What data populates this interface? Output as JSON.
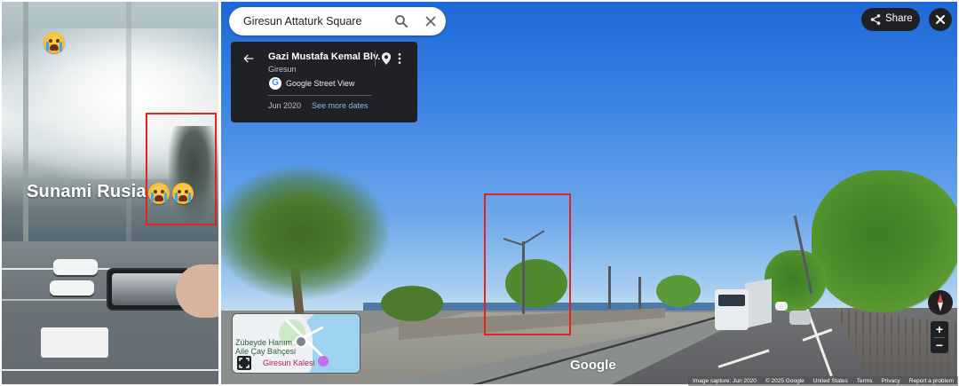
{
  "video_panel": {
    "caption": "Sunami Rusia",
    "emoji_icons": [
      "crying-face-icon",
      "crying-face-icon",
      "crying-face-icon"
    ],
    "highlight_color": "#e02424"
  },
  "street_view": {
    "search": {
      "query": "Giresun Attaturk Square",
      "search_icon": "search-icon",
      "clear_icon": "close-icon"
    },
    "info_card": {
      "street_name": "Gazi Mustafa Kemal Blv.",
      "city": "Giresun",
      "source_label": "Google Street View",
      "capture_date": "Jun 2020",
      "see_more_label": "See more dates"
    },
    "share_label": "Share",
    "zoom_in_label": "+",
    "zoom_out_label": "−",
    "watermark": "Google",
    "minimap": {
      "place_1": "Zübeyde Hanım\nAile Çay Bahçesi",
      "place_2": "Giresun Kalesi"
    },
    "footer_links": [
      "Image capture: Jun 2020",
      "© 2025 Google",
      "United States",
      "Terms",
      "Privacy",
      "Report a problem"
    ],
    "highlight_color": "#e02424"
  }
}
